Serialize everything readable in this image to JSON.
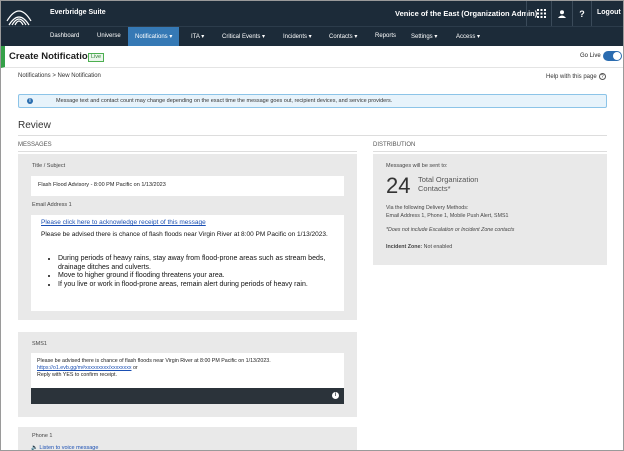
{
  "app": {
    "name": "Everbridge Suite",
    "org": "Venice of the East (Organization Admin)",
    "logout": "Logout",
    "icons": [
      "apps-grid-icon",
      "user-icon",
      "help-icon"
    ]
  },
  "nav": {
    "items": [
      {
        "label": "Dashboard"
      },
      {
        "label": "Universe"
      },
      {
        "label": "Notifications ▾"
      },
      {
        "label": "ITA ▾"
      },
      {
        "label": "Critical Events ▾"
      },
      {
        "label": "Incidents ▾"
      },
      {
        "label": "Contacts ▾"
      },
      {
        "label": "Reports"
      },
      {
        "label": "Settings ▾"
      },
      {
        "label": "Access ▾"
      }
    ],
    "active_index": 2
  },
  "header": {
    "title": "Create Notification",
    "badge": "Live",
    "golive": "Go Live"
  },
  "breadcrumb": "Notifications  >  New Notification",
  "help_text": "Help with this page",
  "banner": "Message text and contact count may change depending on the exact time the message goes out, recipient devices, and service providers.",
  "review_title": "Review",
  "messages": {
    "section_label": "MESSAGES",
    "title_label": "Title / Subject",
    "title_value": "Flash Flood Advisory - 8:00 PM Pacific on 1/13/2023",
    "email_label": "Email Address 1",
    "email_link": "Please click here to acknowledge receipt of this message",
    "email_body": "Please be advised there is chance of flash floods near Virgin River at 8:00 PM Pacific on 1/13/2023.",
    "email_list": [
      "During periods of heavy rains, stay away from flood-prone areas such as stream beds, drainage ditches and culverts.",
      "Move to higher ground if flooding threatens your area.",
      "If you live or work in flood-prone areas, remain alert during periods of heavy rain."
    ],
    "sms_label": "SMS1",
    "sms_line1": "Please be advised there is chance of flash floods near Virgin River at 8:00 PM Pacific on 1/13/2023.",
    "sms_link": "https://o1.evb.gg/m#xxxxxxxxx/xxxxxxxx",
    "sms_link_suffix": " or",
    "sms_line3": "Reply with YES to confirm receipt.",
    "phone_label": "Phone 1",
    "phone_link": "Listen to voice message"
  },
  "distribution": {
    "section_label": "DISTRIBUTION",
    "sent_to": "Messages will be sent to:",
    "count": "24",
    "count_label": "Total Organization Contacts*",
    "methods_label": "Via the following Delivery Methods:",
    "methods": "Email Address 1, Phone 1, Mobile Push Alert, SMS1",
    "note": "*Does not include Escalation or Incident Zone contacts",
    "incident_label": "Incident Zone:",
    "incident_value": " Not enabled"
  }
}
